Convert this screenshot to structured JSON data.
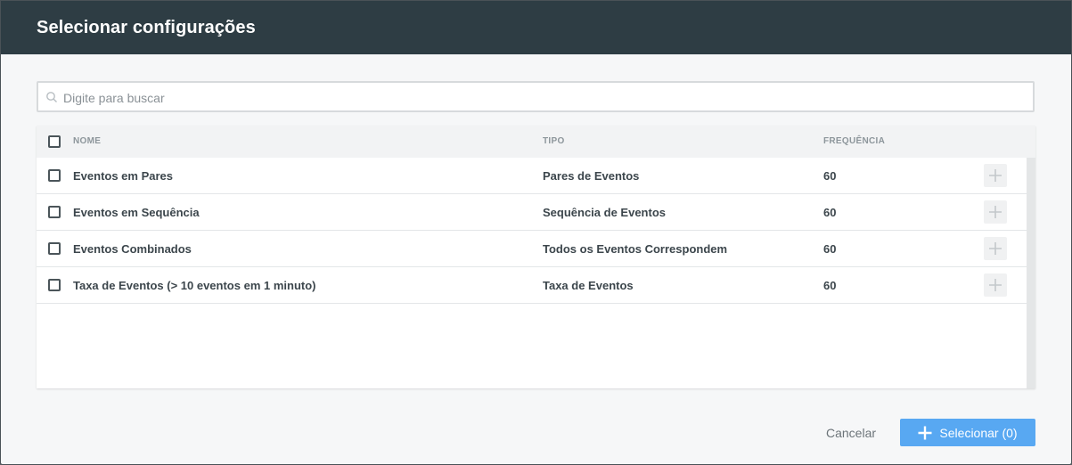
{
  "modal": {
    "title": "Selecionar configurações"
  },
  "search": {
    "placeholder": "Digite para buscar",
    "value": ""
  },
  "table": {
    "columns": {
      "name": "NOME",
      "type": "TIPO",
      "frequency": "FREQUÊNCIA"
    },
    "rows": [
      {
        "name": "Eventos em Pares",
        "type": "Pares de Eventos",
        "frequency": "60"
      },
      {
        "name": "Eventos em Sequência",
        "type": "Sequência de Eventos",
        "frequency": "60"
      },
      {
        "name": "Eventos Combinados",
        "type": "Todos os Eventos Correspondem",
        "frequency": "60"
      },
      {
        "name": "Taxa de Eventos (> 10 eventos em 1 minuto)",
        "type": "Taxa de Eventos",
        "frequency": "60"
      }
    ]
  },
  "footer": {
    "cancel_label": "Cancelar",
    "select_label": "Selecionar (0)"
  },
  "icons": {
    "search": "search-icon",
    "add": "plus-icon"
  },
  "colors": {
    "header_bg": "#2e3d44",
    "primary": "#58a8f2"
  }
}
